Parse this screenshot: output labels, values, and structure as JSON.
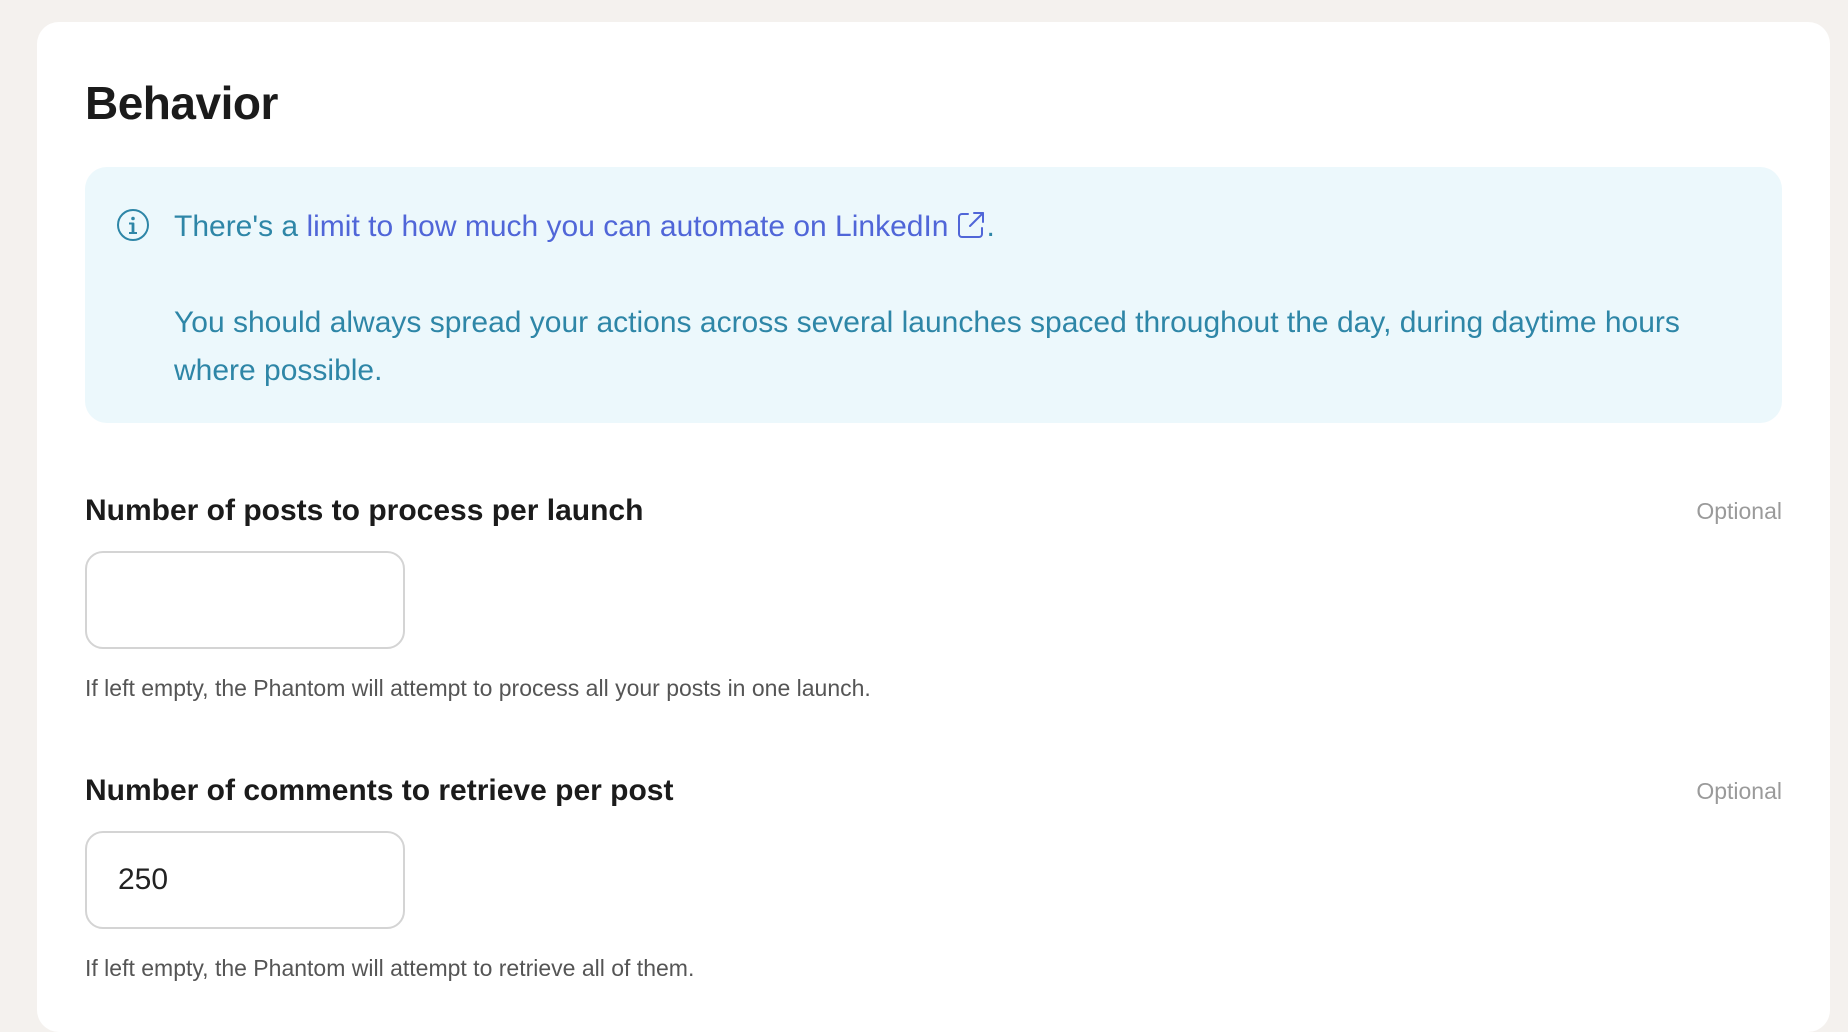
{
  "section": {
    "title": "Behavior"
  },
  "info": {
    "prefix": "There's a ",
    "link_text": "limit to how much you can automate on LinkedIn",
    "suffix": ".",
    "body": "You should always spread your actions across several launches spaced throughout the day, during daytime hours where possible.",
    "icon": "info-circle-icon",
    "link_icon": "external-link-icon",
    "colors": {
      "background": "#ecf8fc",
      "text": "#2e86a7",
      "link": "#5066d8"
    }
  },
  "fields": [
    {
      "label": "Number of posts to process per launch",
      "optional_label": "Optional",
      "value": "",
      "placeholder": "",
      "hint": "If left empty, the Phantom will attempt to process all your posts in one launch."
    },
    {
      "label": "Number of comments to retrieve per post",
      "optional_label": "Optional",
      "value": "250",
      "placeholder": "",
      "hint": "If left empty, the Phantom will attempt to retrieve all of them."
    }
  ]
}
